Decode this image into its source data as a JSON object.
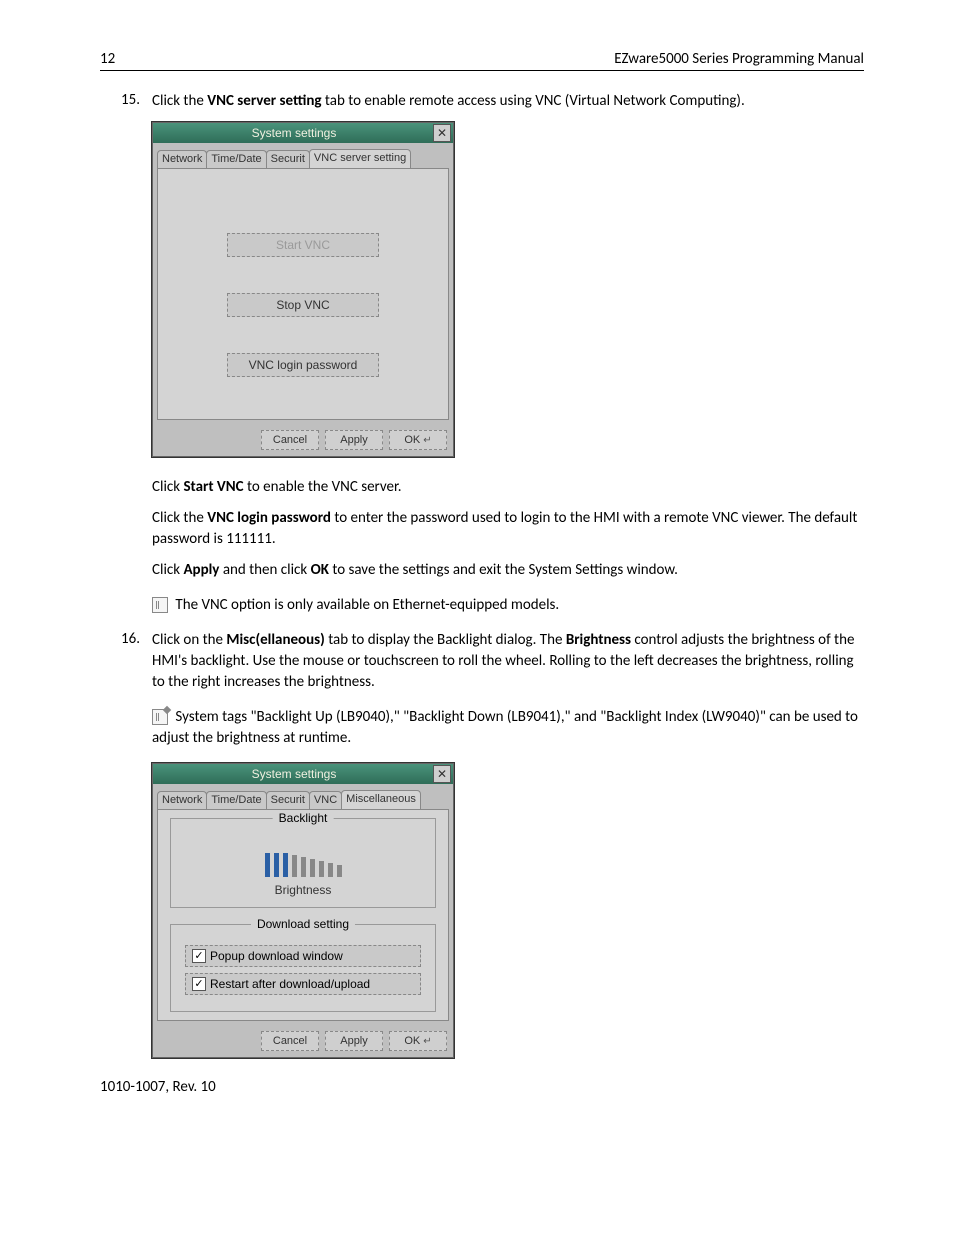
{
  "header": {
    "page_num": "12",
    "doc_title": "EZware5000 Series Programming Manual"
  },
  "step15": {
    "num": "15.",
    "text_before": "Click the ",
    "bold1": "VNC server setting",
    "text_after": " tab to enable remote access using VNC (Virtual Network Computing)."
  },
  "dialog1": {
    "title": "System settings",
    "tabs": [
      "Network",
      "Time/Date",
      "Securit",
      "VNC server setting"
    ],
    "buttons": {
      "start": "Start VNC",
      "stop": "Stop VNC",
      "pwd": "VNC login password"
    },
    "footer": {
      "cancel": "Cancel",
      "apply": "Apply",
      "ok": "OK"
    }
  },
  "p1": {
    "t1": "Click ",
    "b1": "Start VNC",
    "t2": " to enable the VNC server."
  },
  "p2": {
    "t1": "Click the ",
    "b1": "VNC login password",
    "t2": " to enter the password used to login to the HMI with a remote VNC viewer. The default password is 111111."
  },
  "p3": {
    "t1": "Click ",
    "b1": "Apply",
    "t2": " and then click ",
    "b2": "OK",
    "t3": " to save the settings and exit the System Settings window."
  },
  "note1": "The VNC option is only available on Ethernet-equipped models.",
  "step16": {
    "num": "16.",
    "t1": "Click on the ",
    "b1": "Misc(ellaneous)",
    "t2": " tab to display the Backlight dialog. The ",
    "b2": "Brightness",
    "t3": " control adjusts the brightness of the HMI's backlight. Use the mouse or touchscreen to roll the wheel. Rolling to the left decreases the brightness, rolling to the right increases the brightness."
  },
  "note2": "System tags \"Backlight Up (LB9040),\" \"Backlight Down (LB9041),\" and \"Backlight Index (LW9040)\" can be used to adjust the brightness at runtime.",
  "dialog2": {
    "title": "System settings",
    "tabs": [
      "Network",
      "Time/Date",
      "Securit",
      "VNC",
      "Miscellaneous"
    ],
    "backlight_label": "Backlight",
    "brightness_label": "Brightness",
    "download_label": "Download setting",
    "chk1": "Popup download window",
    "chk2": "Restart after download/upload",
    "footer": {
      "cancel": "Cancel",
      "apply": "Apply",
      "ok": "OK"
    }
  },
  "footer_text": "1010-1007, Rev. 10"
}
